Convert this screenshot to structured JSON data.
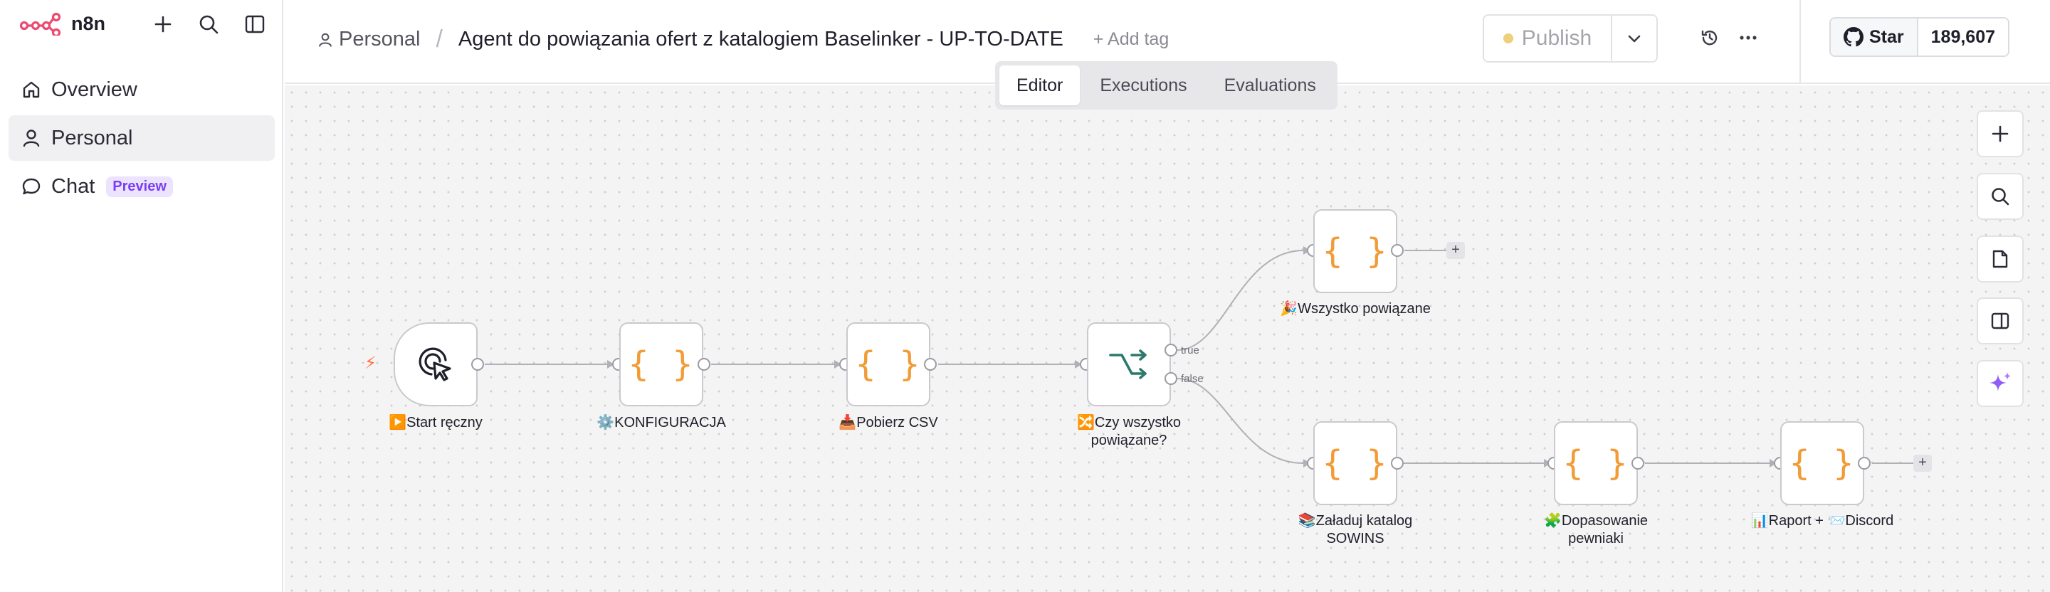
{
  "app": {
    "name": "n8n"
  },
  "sidebar": {
    "items": [
      {
        "label": "Overview",
        "icon": "home-icon"
      },
      {
        "label": "Personal",
        "icon": "user-icon",
        "active": true
      },
      {
        "label": "Chat",
        "icon": "chat-icon",
        "badge": "Preview"
      }
    ]
  },
  "header": {
    "breadcrumb_project": "Personal",
    "workflow_title": "Agent do powiązania ofert z katalogiem Baselinker - UP-TO-DATE",
    "add_tag": "+ Add tag",
    "publish_label": "Publish",
    "github_star": "Star",
    "github_count": "189,607"
  },
  "tabs": [
    {
      "label": "Editor",
      "active": true
    },
    {
      "label": "Executions"
    },
    {
      "label": "Evaluations"
    }
  ],
  "nodes": {
    "start": "▶️Start ręczny",
    "config": "⚙️KONFIGURACJA",
    "csv": "📥Pobierz CSV",
    "if_line1": "🔀Czy wszystko",
    "if_line2": "powiązane?",
    "done": "🎉Wszystko powiązane",
    "load_line1": "📚Załaduj katalog",
    "load_line2": "SOWINS",
    "match_line1": "🧩Dopasowanie",
    "match_line2": "pewniaki",
    "report": "📊Raport + 📨Discord"
  },
  "branches": {
    "true": "true",
    "false": "false"
  },
  "colors": {
    "accent": "#ea4b71",
    "code_icon": "#f29c38",
    "if_icon": "#2b7a6b",
    "preview_badge": "#7a3ff2"
  }
}
